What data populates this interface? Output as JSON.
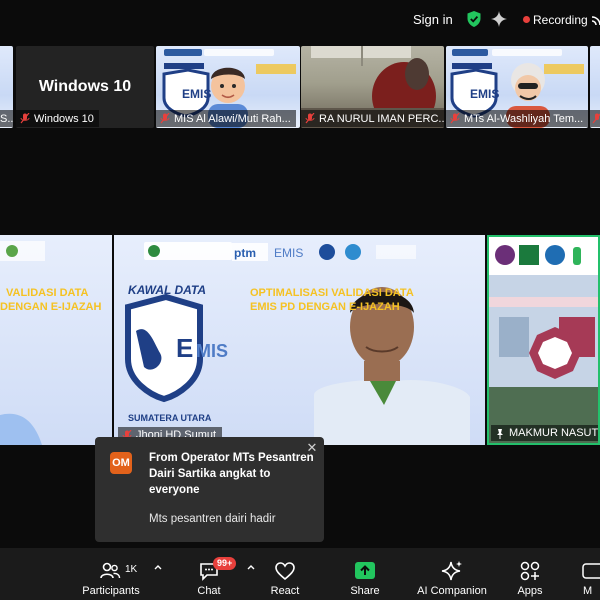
{
  "topbar": {
    "sign_in": "Sign in",
    "recording": "Recording",
    "accent_green": "#22c55e",
    "recording_color": "#e8403c"
  },
  "tiles": [
    {
      "name": "S.."
    },
    {
      "name": "Windows 10",
      "center_text": "Windows 10"
    },
    {
      "name": "MIS Al Alawi/Muti Rah..."
    },
    {
      "name": "RA NURUL IMAN PERC..."
    },
    {
      "name": "MTs Al-Washliyah Tem..."
    },
    {
      "name": ""
    }
  ],
  "stage": {
    "left_slide_text": [
      "VALIDASI DATA",
      "DENGAN E-IJAZAH"
    ],
    "main_slide": {
      "kawal_data": "KAWAL DATA",
      "sumatera_utara": "SUMATERA UTARA",
      "headline_1": "OPTIMALISASI VALIDASI DATA",
      "headline_2": "EMIS PD DENGAN E-IJAZAH",
      "speaker_name": "Jhoni HD Sumut"
    },
    "right_name": "MAKMUR NASUTI..."
  },
  "toast": {
    "avatar_initials": "OM",
    "avatar_color": "#e2621b",
    "title": "From Operator MTs Pesantren Dairi Sartika angkat to everyone",
    "message": "Mts pesantren dairi hadir"
  },
  "toolbar": {
    "participants_label": "Participants",
    "participants_count": "1K",
    "chat_label": "Chat",
    "chat_badge": "99+",
    "react_label": "React",
    "share_label": "Share",
    "share_color": "#22c55e",
    "ai_label": "AI Companion",
    "apps_label": "Apps",
    "more_label": "M"
  }
}
